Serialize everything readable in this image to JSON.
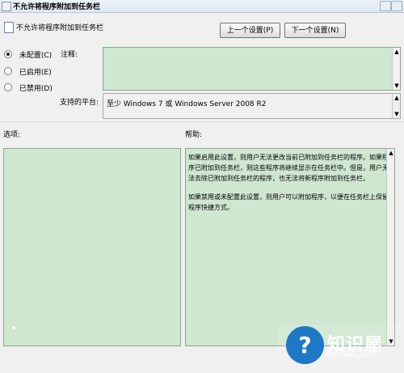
{
  "window": {
    "title": "不允许将程序附加到任务栏"
  },
  "header": {
    "setting_title": "不允许将程序附加到任务栏",
    "prev_button": "上一个设置(P)",
    "next_button": "下一个设置(N)"
  },
  "options": {
    "radio": [
      {
        "label": "未配置(C)",
        "checked": true
      },
      {
        "label": "已启用(E)",
        "checked": false
      },
      {
        "label": "已禁用(D)",
        "checked": false
      }
    ],
    "comment_label": "注释:",
    "platform_label": "支持的平台:",
    "platform_value": "至少 Windows 7 或 Windows Server 2008 R2"
  },
  "panes": {
    "options_label": "选项:",
    "help_label": "帮助:",
    "help_paragraphs": [
      "如果启用此设置，则用户无法更改当前已附加到任务栏的程序。如果程序已附加到任务栏，则这些程序将继续显示在任务栏中。但是，用户无法去除已附加到任务栏的程序，也无法将新程序附加到任务栏。",
      "如果禁用或未配置此设置，则用户可以附加程序，以便在任务栏上保留程序快捷方式。"
    ]
  },
  "watermark": {
    "brand": "知识屋",
    "url": "zhishiwu.com",
    "icon": "question-mark-icon"
  },
  "colors": {
    "pane_green": "#cfe7d1",
    "window_bg": "#f0f0f0",
    "brand_blue": "#1e78c6"
  }
}
